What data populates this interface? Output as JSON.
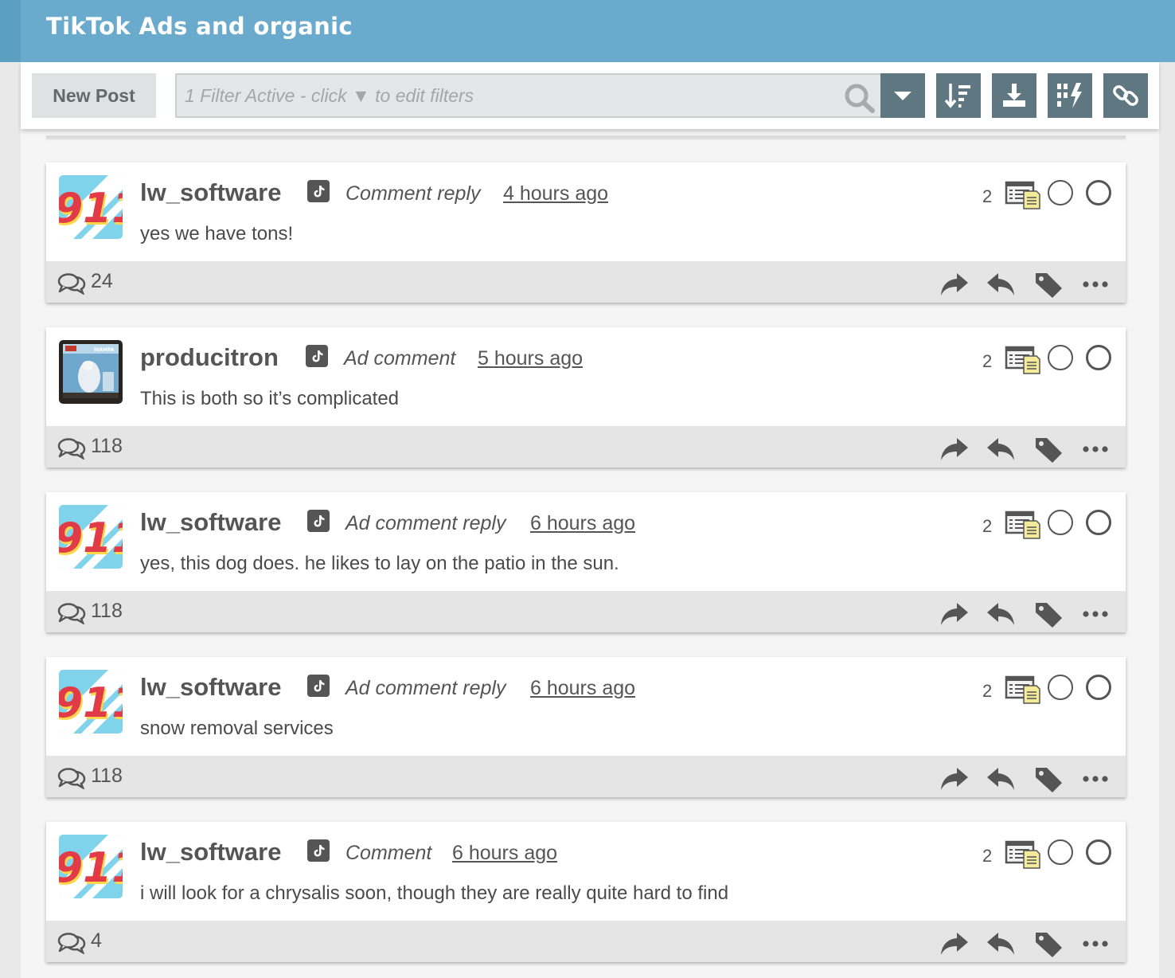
{
  "header": {
    "title": "TikTok Ads and organic"
  },
  "toolbar": {
    "new_post_label": "New Post",
    "filter_placeholder": "1 Filter Active - click ▼ to edit filters",
    "buttons": [
      "chevron-down-icon",
      "sort-icon",
      "download-icon",
      "bolt-icon",
      "link-icon"
    ]
  },
  "colors": {
    "header": "#6aabcd",
    "toolbar_button": "#5f7780",
    "footer": "#e5e5e5"
  },
  "posts": [
    {
      "author": "lw_software",
      "avatar": "911-logo",
      "platform": "tiktok-icon",
      "type": "Comment reply",
      "time": "4 hours ago",
      "message": "yes we have tons!",
      "badge_count": "2",
      "comments": "24"
    },
    {
      "author": "producitron",
      "avatar": "wampa-toy-box",
      "platform": "tiktok-icon",
      "type": "Ad comment",
      "time": "5 hours ago",
      "message": "This is both so it’s complicated",
      "badge_count": "2",
      "comments": "118"
    },
    {
      "author": "lw_software",
      "avatar": "911-logo",
      "platform": "tiktok-icon",
      "type": "Ad comment reply",
      "time": "6 hours ago",
      "message": "yes, this dog does. he likes to lay on the patio in the sun.",
      "badge_count": "2",
      "comments": "118"
    },
    {
      "author": "lw_software",
      "avatar": "911-logo",
      "platform": "tiktok-icon",
      "type": "Ad comment reply",
      "time": "6 hours ago",
      "message": "snow removal services",
      "badge_count": "2",
      "comments": "118"
    },
    {
      "author": "lw_software",
      "avatar": "911-logo",
      "platform": "tiktok-icon",
      "type": "Comment",
      "time": "6 hours ago",
      "message": "i will look for a chrysalis soon, though they are really quite hard to find",
      "badge_count": "2",
      "comments": "4"
    }
  ]
}
